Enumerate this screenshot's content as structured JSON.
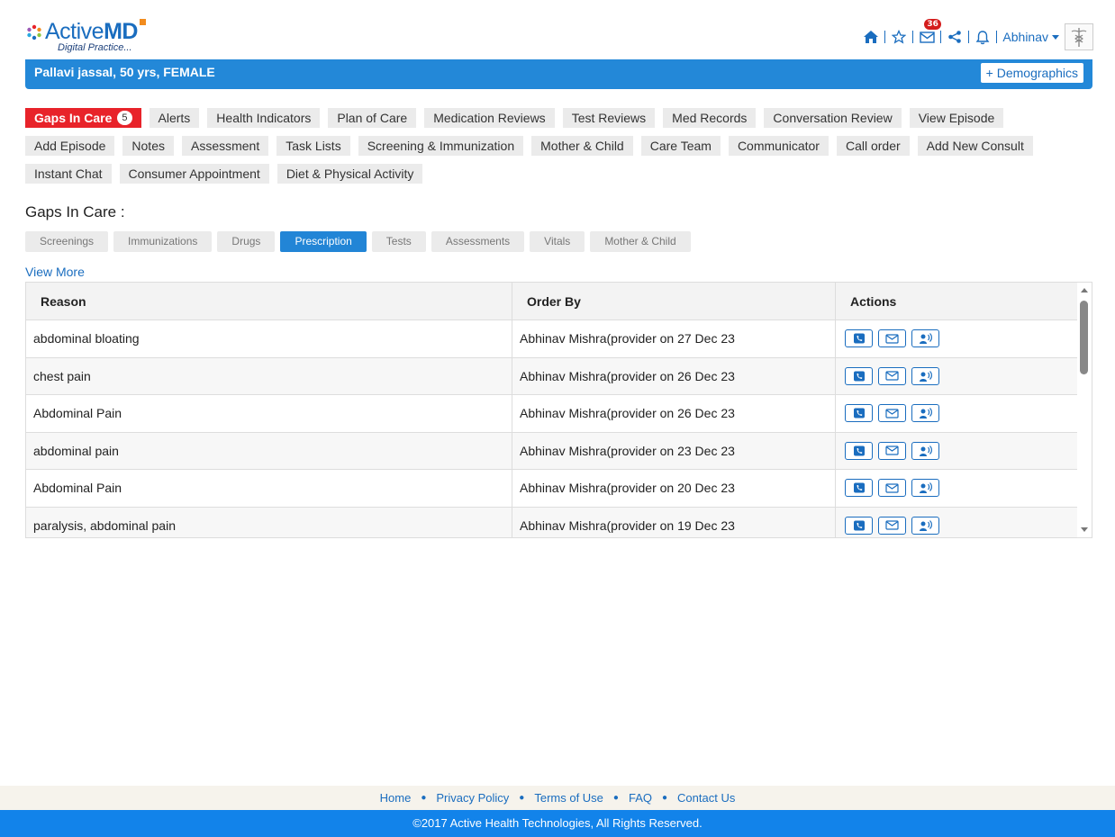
{
  "brand": {
    "name_part1": "Active",
    "name_part2": "MD",
    "tagline": "Digital Practice..."
  },
  "header": {
    "notification_count": "36",
    "user_name": "Abhinav",
    "accent_color": "#1a6dbf"
  },
  "patient": {
    "summary": "Pallavi jassal, 50 yrs, FEMALE",
    "demographics_button": "+ Demographics"
  },
  "nav_tabs": [
    {
      "label": "Gaps In Care",
      "count": "5",
      "active": true
    },
    {
      "label": "Alerts"
    },
    {
      "label": "Health Indicators"
    },
    {
      "label": "Plan of Care"
    },
    {
      "label": "Medication Reviews"
    },
    {
      "label": "Test Reviews"
    },
    {
      "label": "Med Records"
    },
    {
      "label": "Conversation Review"
    },
    {
      "label": "View Episode"
    },
    {
      "label": "Add Episode"
    },
    {
      "label": "Notes"
    },
    {
      "label": "Assessment"
    },
    {
      "label": "Task Lists"
    },
    {
      "label": "Screening & Immunization"
    },
    {
      "label": "Mother & Child"
    },
    {
      "label": "Care Team"
    },
    {
      "label": "Communicator"
    },
    {
      "label": "Call order"
    },
    {
      "label": "Add New Consult"
    },
    {
      "label": "Instant Chat"
    },
    {
      "label": "Consumer Appointment"
    },
    {
      "label": "Diet & Physical Activity"
    }
  ],
  "gaps": {
    "title": "Gaps In Care :",
    "sub_tabs": [
      {
        "label": "Screenings"
      },
      {
        "label": "Immunizations"
      },
      {
        "label": "Drugs"
      },
      {
        "label": "Prescription",
        "active": true
      },
      {
        "label": "Tests"
      },
      {
        "label": "Assessments"
      },
      {
        "label": "Vitals"
      },
      {
        "label": "Mother & Child"
      }
    ],
    "view_more": "View More"
  },
  "table": {
    "columns": [
      "Reason",
      "Order By",
      "Actions"
    ],
    "rows": [
      {
        "reason": "abdominal bloating",
        "order_by": "Abhinav Mishra(provider on 27 Dec 23"
      },
      {
        "reason": "chest pain",
        "order_by": "Abhinav Mishra(provider on 26 Dec 23"
      },
      {
        "reason": "Abdominal Pain",
        "order_by": "Abhinav Mishra(provider on 26 Dec 23"
      },
      {
        "reason": "abdominal pain",
        "order_by": "Abhinav Mishra(provider on 23 Dec 23"
      },
      {
        "reason": "Abdominal Pain",
        "order_by": "Abhinav Mishra(provider on 20 Dec 23"
      },
      {
        "reason": "paralysis, abdominal pain",
        "order_by": "Abhinav Mishra(provider on 19 Dec 23"
      }
    ],
    "action_icons": [
      "phone-icon",
      "email-icon",
      "voice-icon"
    ]
  },
  "footer": {
    "links": [
      "Home",
      "Privacy Policy",
      "Terms of Use",
      "FAQ",
      "Contact Us"
    ],
    "copyright": "©2017 Active Health Technologies, All Rights Reserved."
  }
}
